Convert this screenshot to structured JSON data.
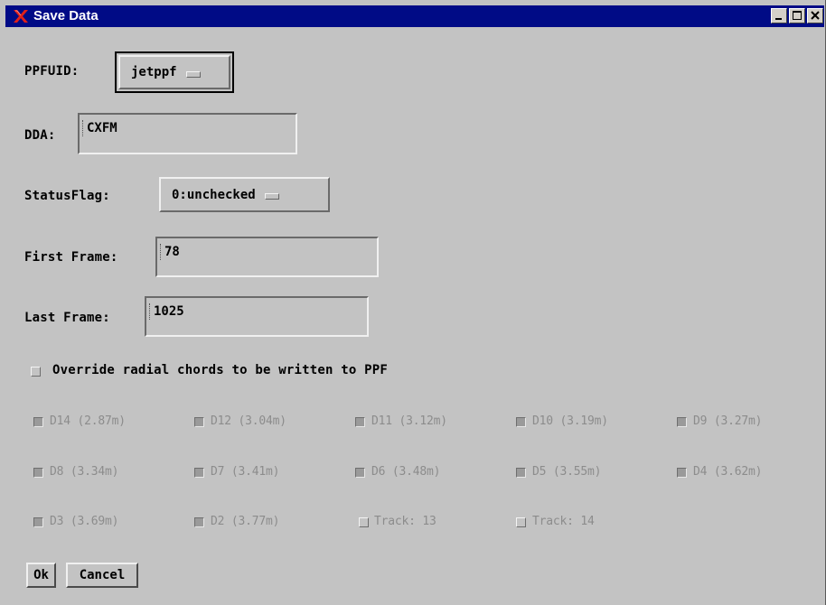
{
  "window": {
    "title": "Save Data",
    "title_color": "#000b86",
    "background": "#c3c3c3",
    "icon": "red-x-icon",
    "controls": [
      "minimize-icon",
      "maximize-icon",
      "close-icon"
    ]
  },
  "ppfuid": {
    "label": "PPFUID:",
    "value": "jetppf"
  },
  "dda": {
    "label": "DDA:",
    "value": "CXFM"
  },
  "status_flag": {
    "label": "StatusFlag:",
    "value": "0:unchecked"
  },
  "first_frame": {
    "label": "First Frame:",
    "value": "78"
  },
  "last_frame": {
    "label": "Last Frame:",
    "value": "1025"
  },
  "override": {
    "label": "Override radial chords to be written to PPF",
    "checked": false
  },
  "chords": [
    {
      "label": "D14 (2.87m)",
      "checked": true
    },
    {
      "label": "D12 (3.04m)",
      "checked": true
    },
    {
      "label": "D11 (3.12m)",
      "checked": true
    },
    {
      "label": "D10 (3.19m)",
      "checked": true
    },
    {
      "label": "D9 (3.27m)",
      "checked": true
    },
    {
      "label": "D8 (3.34m)",
      "checked": true
    },
    {
      "label": "D7 (3.41m)",
      "checked": true
    },
    {
      "label": "D6 (3.48m)",
      "checked": true
    },
    {
      "label": "D5 (3.55m)",
      "checked": true
    },
    {
      "label": "D4 (3.62m)",
      "checked": true
    },
    {
      "label": "D3 (3.69m)",
      "checked": true
    },
    {
      "label": "D2 (3.77m)",
      "checked": true
    },
    {
      "label": "Track: 13",
      "checked": false
    },
    {
      "label": "Track: 14",
      "checked": false
    }
  ],
  "buttons": {
    "ok": "Ok",
    "cancel": "Cancel"
  }
}
